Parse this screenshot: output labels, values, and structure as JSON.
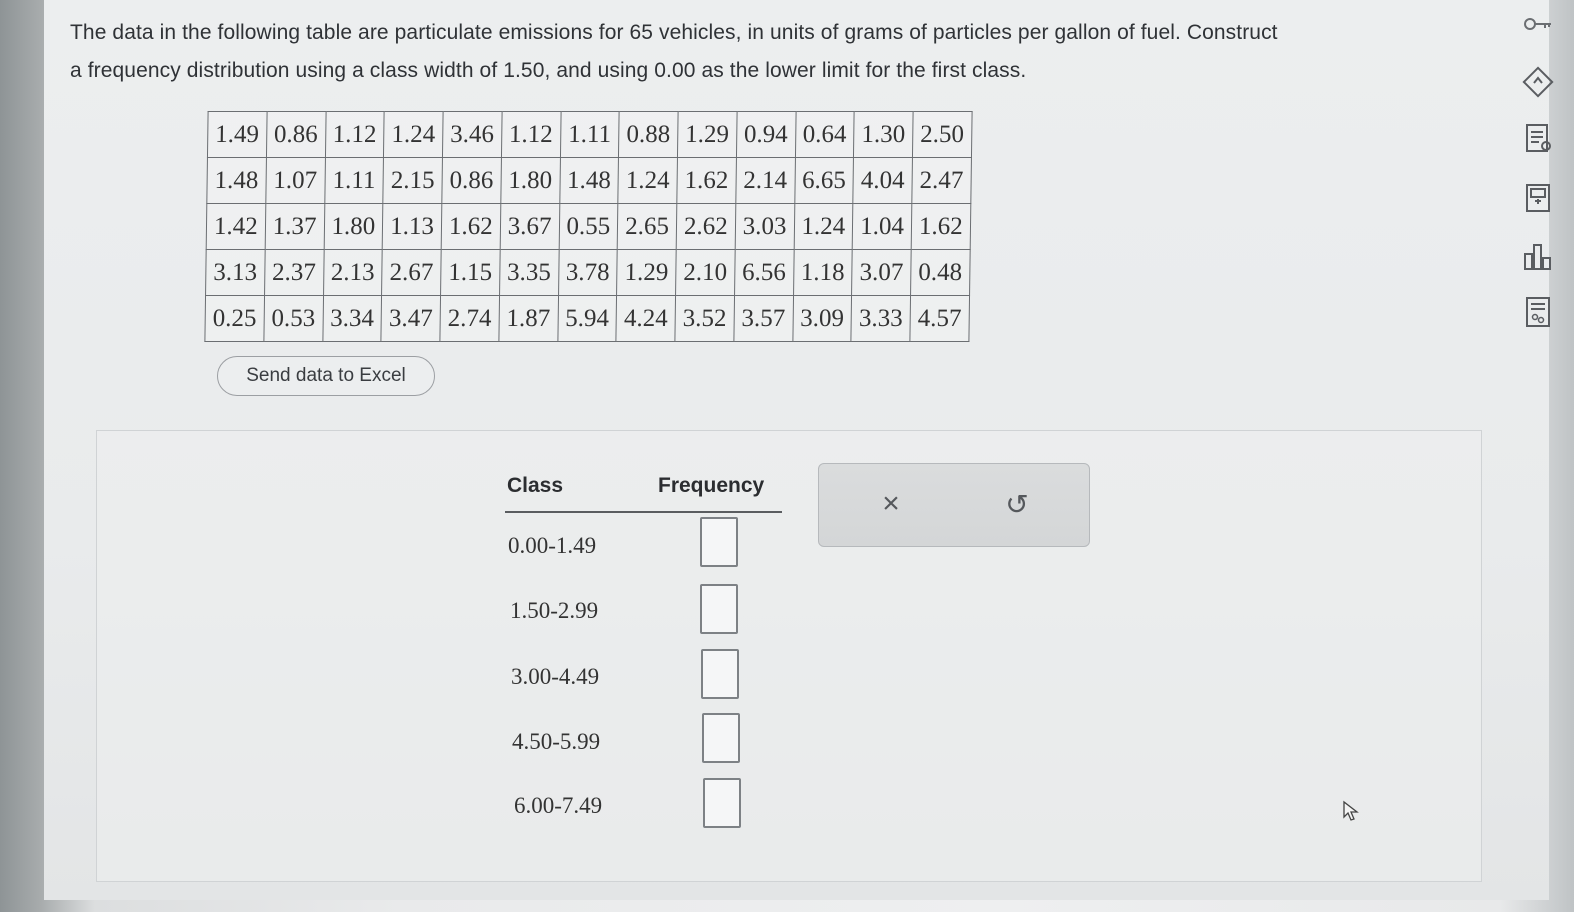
{
  "question": {
    "line1": "The data in the following table are particulate emissions for 65 vehicles, in units of grams of particles per gallon of fuel. Construct",
    "line2": "a frequency distribution using a class width of 1.50, and using 0.00 as the lower limit for the first class."
  },
  "data_table": {
    "rows": [
      [
        "1.49",
        "0.86",
        "1.12",
        "1.24",
        "3.46",
        "1.12",
        "1.11",
        "0.88",
        "1.29",
        "0.94",
        "0.64",
        "1.30",
        "2.50"
      ],
      [
        "1.48",
        "1.07",
        "1.11",
        "2.15",
        "0.86",
        "1.80",
        "1.48",
        "1.24",
        "1.62",
        "2.14",
        "6.65",
        "4.04",
        "2.47"
      ],
      [
        "1.42",
        "1.37",
        "1.80",
        "1.13",
        "1.62",
        "3.67",
        "0.55",
        "2.65",
        "2.62",
        "3.03",
        "1.24",
        "1.04",
        "1.62"
      ],
      [
        "3.13",
        "2.37",
        "2.13",
        "2.67",
        "1.15",
        "3.35",
        "3.78",
        "1.29",
        "2.10",
        "6.56",
        "1.18",
        "3.07",
        "0.48"
      ],
      [
        "0.25",
        "0.53",
        "3.34",
        "3.47",
        "2.74",
        "1.87",
        "5.94",
        "4.24",
        "3.52",
        "3.57",
        "3.09",
        "3.33",
        "4.57"
      ]
    ]
  },
  "excel_button": {
    "label": "Send data to Excel"
  },
  "frequency_table": {
    "class_header": "Class",
    "frequency_header": "Frequency",
    "classes": [
      "0.00-1.49",
      "1.50-2.99",
      "3.00-4.49",
      "4.50-5.99",
      "6.00-7.49"
    ],
    "frequencies": [
      "",
      "",
      "",
      "",
      ""
    ]
  },
  "tools": {
    "clear_symbol": "×",
    "undo_symbol": "↺"
  },
  "sidebar_icons": [
    "key-icon",
    "explanation-icon",
    "textbook-icon",
    "calculator-icon",
    "chart-icon",
    "periodic-table-icon"
  ]
}
